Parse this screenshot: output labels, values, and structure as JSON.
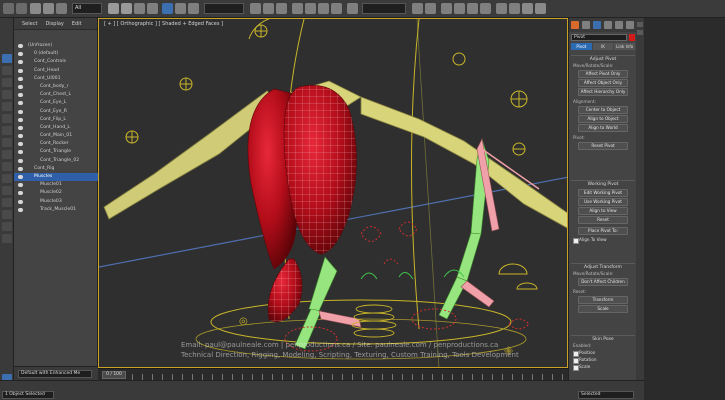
{
  "colors": {
    "accent": "#2e5fa8",
    "rig_bone": "#d8d47a",
    "rig_green": "#7fdc6a",
    "mesh_red": "#c8141e",
    "helper_yellow": "#c9b52a"
  },
  "toolbar": {
    "selection_filter": "All",
    "named_set": ""
  },
  "explorer": {
    "menu": [
      "Select",
      "Display",
      "Edit"
    ],
    "items": [
      {
        "label": "(Unfrozen)",
        "indent": 0
      },
      {
        "label": "0 (default)",
        "indent": 1
      },
      {
        "label": "Cont_Controls",
        "indent": 1
      },
      {
        "label": "Cont_Head",
        "indent": 1
      },
      {
        "label": "Cont_UI001",
        "indent": 1
      },
      {
        "label": "Cont_body_r",
        "indent": 2
      },
      {
        "label": "Cont_Chest_L",
        "indent": 2
      },
      {
        "label": "Cont_Eye_L",
        "indent": 2
      },
      {
        "label": "Cont_Eye_R",
        "indent": 2
      },
      {
        "label": "Cont_Flip_L",
        "indent": 2
      },
      {
        "label": "Cont_Hand_L",
        "indent": 2
      },
      {
        "label": "Cont_Main_01",
        "indent": 2
      },
      {
        "label": "Cont_Rocker",
        "indent": 2
      },
      {
        "label": "Cont_Triangle",
        "indent": 2
      },
      {
        "label": "Cont_Triangle_02",
        "indent": 2
      },
      {
        "label": "Cont_Rig",
        "indent": 1
      },
      {
        "label": "Muscles",
        "indent": 1,
        "selected": true
      },
      {
        "label": "Muscle01",
        "indent": 2
      },
      {
        "label": "Muscle02",
        "indent": 2
      },
      {
        "label": "Muscle03",
        "indent": 2
      },
      {
        "label": "Track_Muscle01",
        "indent": 2
      }
    ],
    "footer_mode": "Default with Enhanced Me"
  },
  "viewport": {
    "label": "[ + ] [ Orthographic ] [ Shaded + Edged Faces ]",
    "watermark_1": "Email: paul@paulneale.com | penproductions.ca / Site: paulneale.com / penproductions.ca",
    "watermark_2": "Technical Direction, Rigging, Modeling, Scripting, Texturing, Custom Training, Tools Development"
  },
  "timeline": {
    "position": "0 / 100"
  },
  "command_panel": {
    "object_name": "Pivot",
    "subtabs": [
      "Pivot",
      "IK",
      "Link Info"
    ],
    "adjust_pivot": {
      "title": "Adjust Pivot",
      "move_label": "Move/Rotate/Scale:",
      "buttons": [
        "Affect Pivot Only",
        "Affect Object Only",
        "Affect Hierarchy Only"
      ],
      "alignment_label": "Alignment:",
      "align_buttons": [
        "Center to Object",
        "Align to Object",
        "Align to World"
      ],
      "pivot_label": "Pivot:",
      "reset_button": "Reset Pivot"
    },
    "working_pivot": {
      "title": "Working Pivot",
      "buttons": [
        "Edit Working Pivot",
        "Use Working Pivot",
        "Align to View",
        "Reset"
      ],
      "place_button": "Place Pivot To:",
      "align_check": "Align To View"
    },
    "adjust_transform": {
      "title": "Adjust Transform",
      "move_label": "Move/Rotate/Scale:",
      "buttons": [
        "Don't Affect Children"
      ],
      "reset_label": "Reset:",
      "reset_buttons": [
        "Transform",
        "Scale"
      ]
    },
    "skin_pose": {
      "title": "Skin Pose",
      "enabled_label": "Enabled:",
      "checks": [
        "Position",
        "Rotation",
        "Scale"
      ]
    }
  },
  "status": {
    "selection": "1 Object Selected",
    "mode": "Selected"
  }
}
